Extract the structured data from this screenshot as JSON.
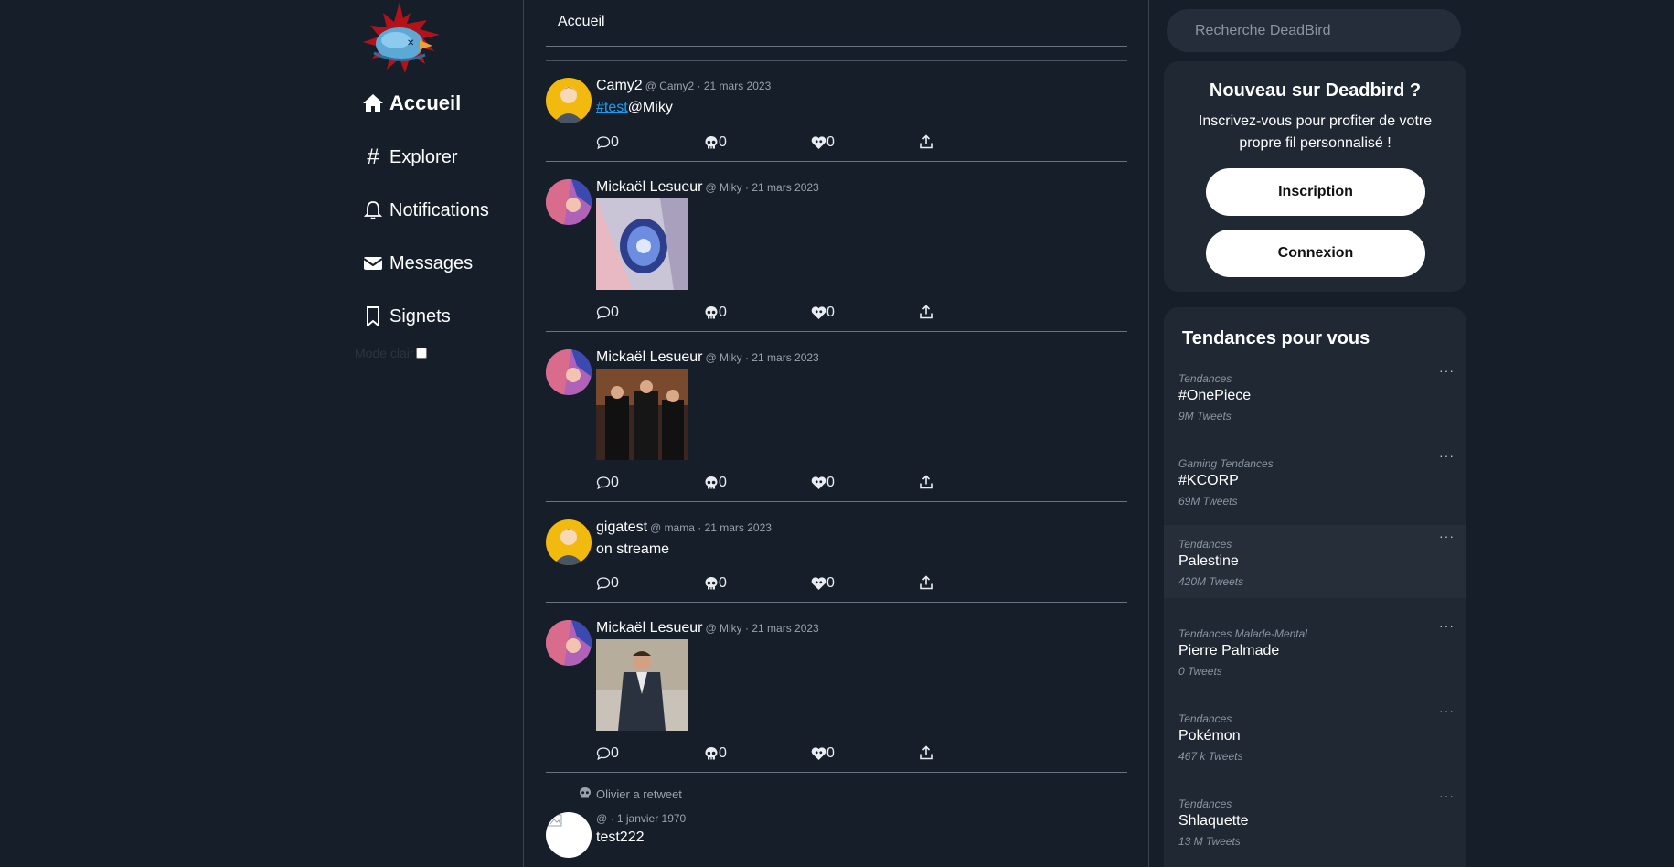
{
  "sidebar": {
    "nav": [
      {
        "label": "Accueil",
        "icon": "home-icon"
      },
      {
        "label": "Explorer",
        "icon": "hashtag-icon"
      },
      {
        "label": "Notifications",
        "icon": "bell-icon"
      },
      {
        "label": "Messages",
        "icon": "envelope-icon"
      },
      {
        "label": "Signets",
        "icon": "bookmark-icon"
      }
    ],
    "mode_label": "Mode clair"
  },
  "feed": {
    "header": "Accueil",
    "tweets": [
      {
        "name": "Camy2",
        "meta": "@ Camy2 · 21 mars 2023",
        "tag": "#test",
        "text": "@Miky",
        "likes": "0",
        "comments": "0",
        "retweets": "0"
      },
      {
        "name": "Mickaël Lesueur",
        "meta": "@ Miky · 21 mars 2023",
        "comments": "0",
        "retweets": "0",
        "likes": "0"
      },
      {
        "name": "Mickaël Lesueur",
        "meta": "@ Miky · 21 mars 2023",
        "comments": "0",
        "retweets": "0",
        "likes": "0"
      },
      {
        "name": "gigatest",
        "meta": "@ mama · 21 mars 2023",
        "text": "on streame",
        "comments": "0",
        "retweets": "0",
        "likes": "0"
      },
      {
        "name": "Mickaël Lesueur",
        "meta": "@ Miky · 21 mars 2023",
        "comments": "0",
        "retweets": "0",
        "likes": "0"
      },
      {
        "retweeted_by": "Olivier a retweet",
        "meta": "@ · 1 janvier 1970",
        "text": "test222"
      }
    ]
  },
  "right": {
    "search_placeholder": "Recherche DeadBird",
    "signup": {
      "title": "Nouveau sur Deadbird ?",
      "subtitle": "Inscrivez-vous pour profiter de votre propre fil personnalisé !",
      "register": "Inscription",
      "login": "Connexion"
    },
    "trends": {
      "title": "Tendances pour vous",
      "more": "···",
      "items": [
        {
          "category": "Tendances",
          "name": "#OnePiece",
          "count": "9M Tweets"
        },
        {
          "category": "Gaming Tendances",
          "name": "#KCORP",
          "count": "69M Tweets"
        },
        {
          "category": "Tendances",
          "name": "Palestine",
          "count": "420M Tweets"
        },
        {
          "category": "Tendances Malade-Mental",
          "name": "Pierre Palmade",
          "count": "0 Tweets"
        },
        {
          "category": "Tendances",
          "name": "Pokémon",
          "count": "467 k Tweets"
        },
        {
          "category": "Tendances",
          "name": "Shlaquette",
          "count": "13 M Tweets"
        }
      ]
    }
  },
  "colors": {
    "background": "#151e29",
    "card": "#1f2833",
    "link": "#1d9bf0",
    "muted": "#9aa3ad"
  }
}
